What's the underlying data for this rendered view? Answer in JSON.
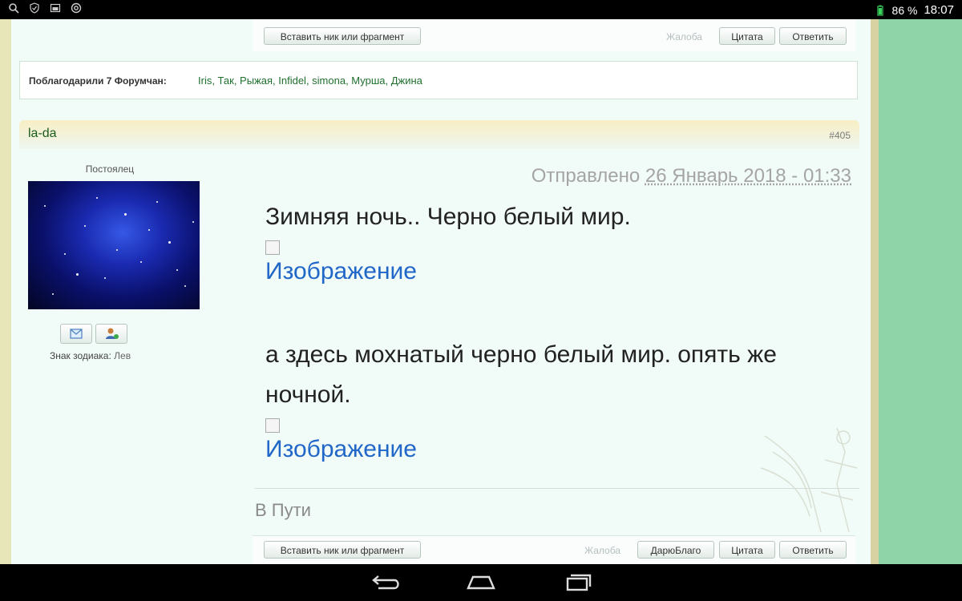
{
  "status_bar": {
    "battery": "86 %",
    "time": "18:07",
    "icons": [
      "search-icon",
      "shield-icon",
      "image-icon",
      "at-icon",
      "battery-icon"
    ]
  },
  "top_buttons": {
    "insert_label": "Вставить ник или фрагмент",
    "complain_label": "Жалоба",
    "quote_label": "Цитата",
    "reply_label": "Ответить"
  },
  "thanks": {
    "label": "Поблагодарили 7 Форумчан:",
    "names": "Iris, Так, Рыжая, Infidel, simona, Мурша, Джина"
  },
  "post": {
    "author": "la-da",
    "number": "#405",
    "rank": "Постоялец",
    "zodiac_label": "Знак зодиака:",
    "zodiac_value": "Лев",
    "sent_label": "Отправлено",
    "sent_date": "26 Январь 2018 - 01:33",
    "line1": "Зимняя ночь.. Черно белый мир.",
    "image_link": "Изображение",
    "line2": "а здесь мохнатый черно белый мир. опять же",
    "line3": "ночной.",
    "signature": "В Пути"
  },
  "bottom_buttons": {
    "insert_label": "Вставить ник или фрагмент",
    "complain_label": "Жалоба",
    "thanks_label": "ДарюБлаго",
    "quote_label": "Цитата",
    "reply_label": "Ответить"
  },
  "nav_bar": {
    "icons": [
      "back-icon",
      "home-icon",
      "recent-apps-icon"
    ]
  }
}
